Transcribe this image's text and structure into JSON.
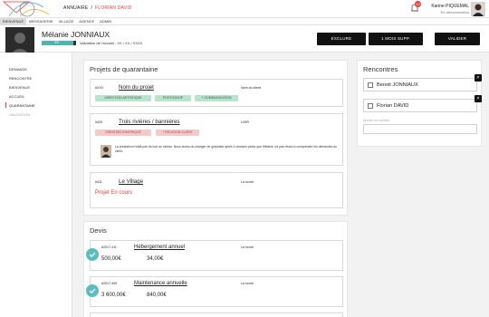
{
  "topbar": {
    "crumb_left": "ANNUAIRE",
    "crumb_sep": "/",
    "crumb_right": "FLORIAN DAVID",
    "notif_count": "10",
    "user_name": "Karine PIQUEMAL",
    "user_role": "En démonstration"
  },
  "nav": {
    "items": [
      "BIENVENUE",
      "MESSAGERIE",
      "VILLAGE",
      "AGENCE",
      "ADMIN"
    ]
  },
  "profile": {
    "name": "Mélanie JONNIAUX",
    "progress_text": "5/5",
    "progress_fraction": 0.92,
    "validation": "Validation de l'accueil : XX / XX / XXXX"
  },
  "actions": {
    "exclude": "EXCLURE",
    "suspend": "1 MOIS SUPP.",
    "validate": "VALIDER"
  },
  "sidebar": {
    "items": [
      "DEMANDE",
      "RENCONTRE",
      "BIENVENUE",
      "ACCUEIL",
      "QUARANTAINE",
      "VALIDATION"
    ]
  },
  "projects": {
    "title": "Projets de quarantaine",
    "cards": [
      {
        "num": "#XXX",
        "title": "Nom du projet",
        "client": "Nom du client",
        "tags": [
          "DIRECTION ARTISTIQUE",
          "PHOTOSHOP",
          "+ COMMUNICATION"
        ]
      },
      {
        "num": "#425",
        "title": "Trois rivières / bannières",
        "client": "LIXIR",
        "tags": [
          "CRÉATION GRAPHIQUE",
          "+ RELATION CLIENT"
        ],
        "comment": "La prestation n'était pas du tout au niveau. Nous avons du changer de graphiste après 4 versions parce que Mélanie n'a pas réussi à comprendre les demandes du client."
      },
      {
        "num": "#411",
        "title": "Le Village",
        "client": "La ruche",
        "status": "Projet En cours"
      }
    ]
  },
  "devis": {
    "title": "Devis",
    "items": [
      {
        "num": "#2017-411",
        "title": "Hébergement annuel",
        "client": "La ruche",
        "price1": "500,00€",
        "price2": "34,00€"
      },
      {
        "num": "#2017-409",
        "title": "Maintenance annuelle",
        "client": "La ruche",
        "price1": "3 600,00€",
        "price2": "840,00€"
      }
    ]
  },
  "rencontres": {
    "title": "Rencontres",
    "people": [
      "Benoit JONNIAUX",
      "Florian DAVID"
    ],
    "add_label": "Ajouter un contact",
    "remove": "×"
  },
  "colors": {
    "accent_red": "#e0403a",
    "teal": "#4db3b3",
    "tag_green": "#b9e3cc",
    "tag_pink": "#f4c9c9"
  }
}
